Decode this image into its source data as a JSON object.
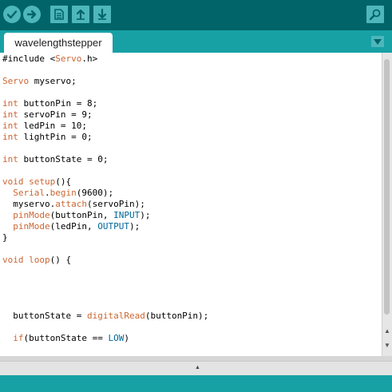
{
  "toolbar": {
    "buttons": [
      {
        "name": "verify-button",
        "icon": "checkmark-icon"
      },
      {
        "name": "upload-button",
        "icon": "arrow-right-icon"
      },
      {
        "name": "new-button",
        "icon": "new-file-icon"
      },
      {
        "name": "open-button",
        "icon": "arrow-up-icon"
      },
      {
        "name": "save-button",
        "icon": "arrow-down-icon"
      },
      {
        "name": "serial-monitor-button",
        "icon": "magnifier-icon"
      }
    ]
  },
  "tabs": [
    {
      "label": "wavelengthstepper",
      "active": true
    }
  ],
  "editor": {
    "lines": [
      "#include <Servo.h>",
      "",
      "Servo myservo;",
      "",
      "int buttonPin = 8;",
      "int servoPin = 9;",
      "int ledPin = 10;",
      "int lightPin = 0;",
      "",
      "int buttonState = 0;",
      "",
      "void setup(){",
      "  Serial.begin(9600);",
      "  myservo.attach(servoPin);",
      "  pinMode(buttonPin, INPUT);",
      "  pinMode(ledPin, OUTPUT);",
      "}",
      "",
      "void loop() {",
      "",
      "",
      "",
      "",
      "  buttonState = digitalRead(buttonPin);",
      "",
      "  if(buttonState == LOW)",
      "",
      "  {"
    ]
  },
  "colors": {
    "toolbar_bg": "#006468",
    "tabstrip_bg": "#17a1a5",
    "button_bg": "#4db7bb",
    "keyword": "#cc6633",
    "constant": "#006699"
  }
}
